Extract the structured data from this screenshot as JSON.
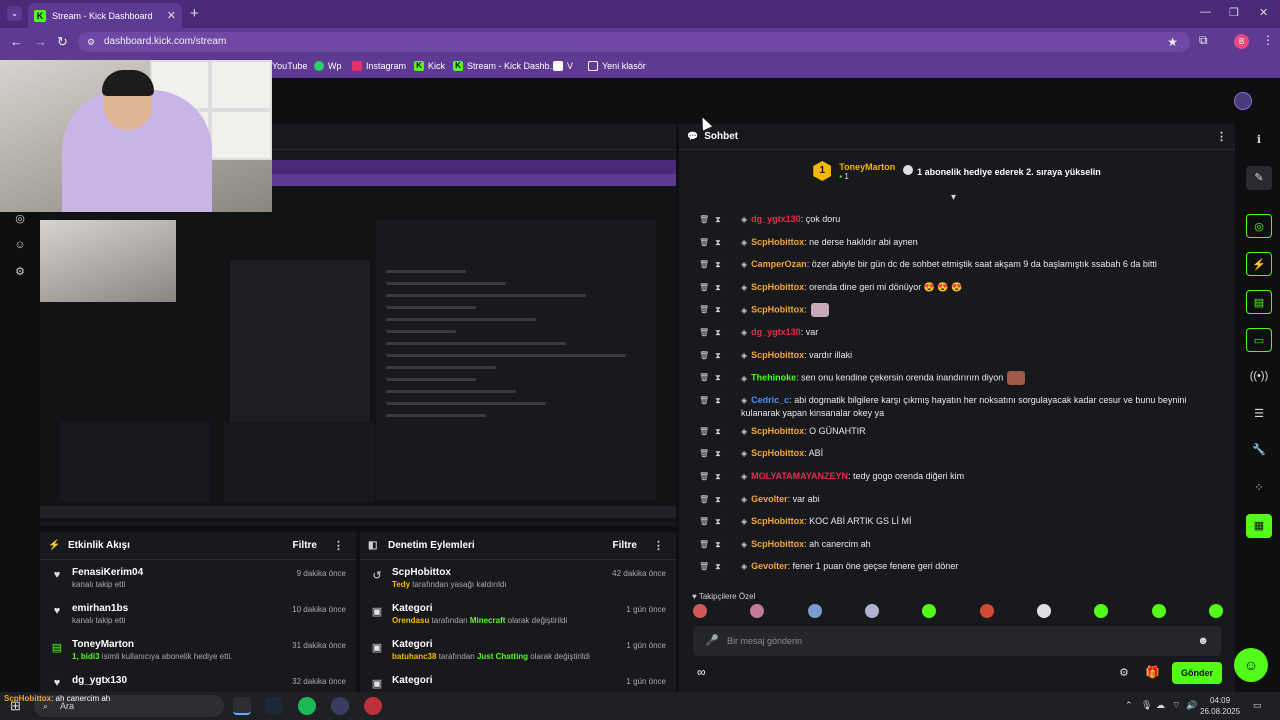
{
  "browser": {
    "tab_title": "Stream - Kick Dashboard",
    "url": "dashboard.kick.com/stream",
    "profile_initial": "B",
    "bookmarks": [
      "YouTube",
      "Wp",
      "Instagram",
      "Kick",
      "Stream - Kick Dashb...",
      "V",
      "Yeni klasör"
    ]
  },
  "colors": {
    "brand_green": "#53fc18",
    "browser_purple": "#5e3a92",
    "panel_bg": "#18191c"
  },
  "activity_feed": {
    "title": "Etkinlik Akışı",
    "filter_label": "Filtre",
    "items": [
      {
        "name": "FenasiKerim04",
        "sub": "kanalı takip etti",
        "time": "9 dakika önce",
        "icon": "heart-icon"
      },
      {
        "name": "emirhan1bs",
        "sub": "kanalı takip etti",
        "time": "10 dakika önce",
        "icon": "heart-icon"
      },
      {
        "name": "ToneyMarton",
        "sub_green": "1, bidi3",
        "sub": " isimli kullanıcıya abonelik hediye etti.",
        "time": "31 dakika önce",
        "icon": "gift-icon"
      },
      {
        "name": "dg_ygtx130",
        "sub": "",
        "time": "32 dakika önce",
        "icon": "heart-icon"
      }
    ]
  },
  "moderation": {
    "title": "Denetim Eylemleri",
    "filter_label": "Filtre",
    "items": [
      {
        "name": "ScpHobittox",
        "green": "Tedy",
        "rest": " tarafından yasağı kaldırıldı",
        "time": "42 dakika önce"
      },
      {
        "name": "Kategori",
        "green": "Orendasu",
        "rest": " tarafından ",
        "green2": "Minecraft",
        "rest2": " olarak değiştirildi",
        "time": "1 gün önce"
      },
      {
        "name": "Kategori",
        "green": "batuhanc38",
        "rest": " tarafından ",
        "green2": "Just Chatting",
        "rest2": " olarak değiştirildi",
        "time": "1 gün önce"
      },
      {
        "name": "Kategori",
        "green": "",
        "rest": "",
        "green2": "",
        "rest2": "",
        "time": "1 gün önce"
      }
    ]
  },
  "chat": {
    "title": "Sohbet",
    "pinned_user": "ToneyMarton",
    "pinned_rank": "1",
    "pinned_count": "1",
    "pinned_text": "1 abonelik hediye ederek 2. sıraya yükselin",
    "messages": [
      {
        "user": "dg_ygtx130",
        "color": "#e0304a",
        "text": ": çok doru"
      },
      {
        "user": "ScpHobittox",
        "color": "#f2a63a",
        "text": ": ne derse haklıdır abi aynen"
      },
      {
        "user": "CamperOzan",
        "color": "#f2a63a",
        "text": ": özer abiyle bir gün dc de sohbet etmiştik saat akşam 9 da başlamıştık ssabah 6 da bitti"
      },
      {
        "user": "ScpHobittox",
        "color": "#f2a63a",
        "text": ": orenda dine geri mi dönüyor 😍 😍 😍"
      },
      {
        "user": "ScpHobittox",
        "color": "#f2a63a",
        "text": ":"
      },
      {
        "user": "dg_ygtx130",
        "color": "#e0304a",
        "text": ": var"
      },
      {
        "user": "ScpHobittox",
        "color": "#f2a63a",
        "text": ": vardır illaki"
      },
      {
        "user": "Thehinoke",
        "color": "#53fc18",
        "text": ": sen onu kendine çekersin orenda inandırırım diyon"
      },
      {
        "user": "Cedric_c",
        "color": "#4a8cff",
        "text": ": abi dogmatik bilgilere karşı çıkmış hayatın her noksatını sorgulayacak kadar cesur ve bunu beynini kulanarak yapan kinsanalar okey ya"
      },
      {
        "user": "ScpHobittox",
        "color": "#f2a63a",
        "text": ": O GÜNAHTIR"
      },
      {
        "user": "ScpHobittox",
        "color": "#f2a63a",
        "text": ": ABİ"
      },
      {
        "user": "MOLYATAMAYANZEYN",
        "color": "#e0304a",
        "text": ": tedy gogo orenda diğeri kim"
      },
      {
        "user": "Gevolter",
        "color": "#f2a63a",
        "text": ": var abi"
      },
      {
        "user": "ScpHobittox",
        "color": "#f2a63a",
        "text": ": KOC ABİ ARTIK GS Lİ Mİ"
      },
      {
        "user": "ScpHobittox",
        "color": "#f2a63a",
        "text": ": ah canercim ah"
      },
      {
        "user": "Gevolter",
        "color": "#f2a63a",
        "text": ": fener 1 puan öne geçse fenere geri döner"
      }
    ],
    "followers_label": "Takipçilere Özel",
    "input_placeholder": "Bir mesaj gönderin",
    "send_label": "Gönder"
  },
  "taskbar": {
    "search_placeholder": "Ara",
    "time": "04:09",
    "date": "26.08.2025",
    "overlay_user": "ScpHobittox",
    "overlay_text": ": ah canercim ah"
  }
}
